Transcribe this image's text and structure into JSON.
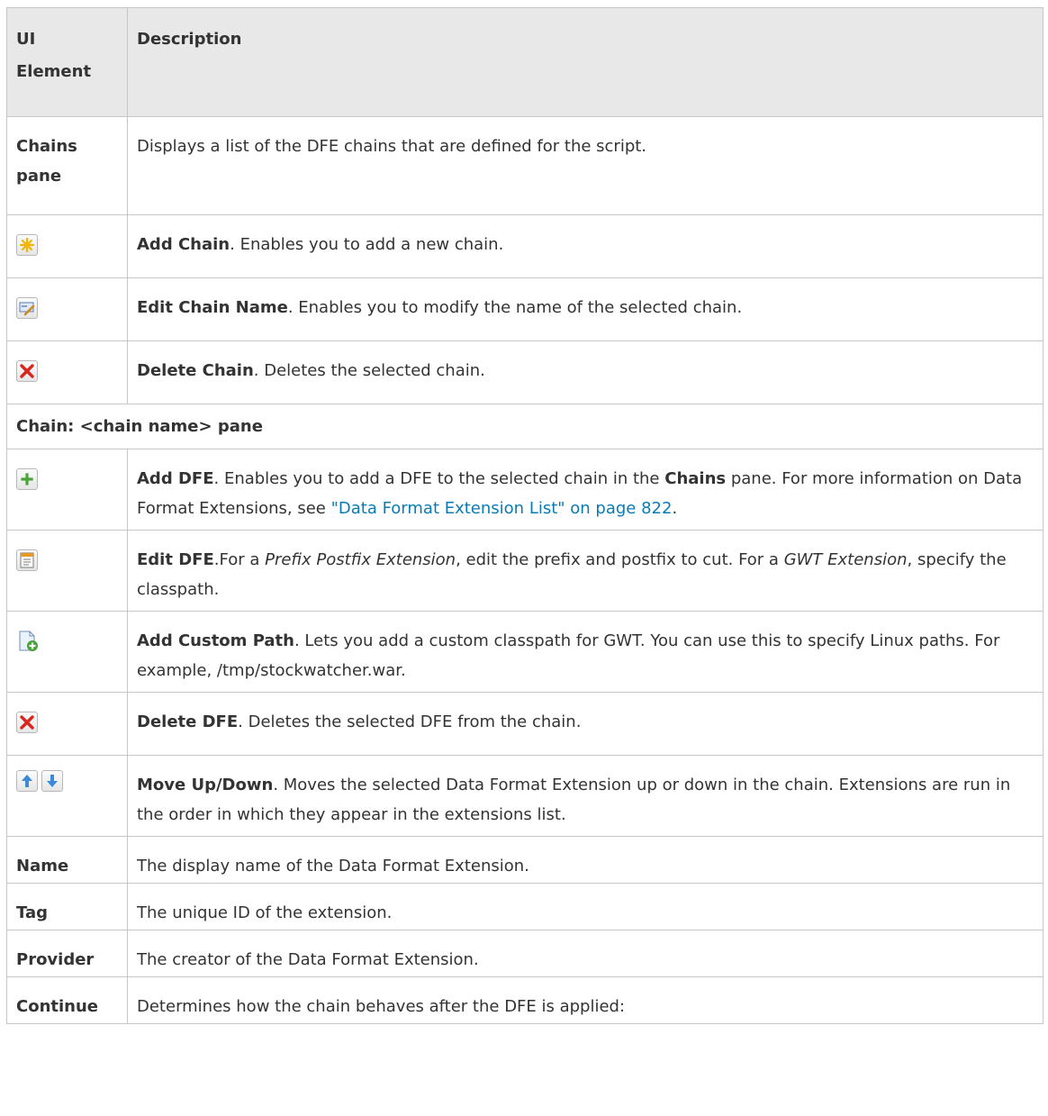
{
  "header": {
    "col1": "UI Element",
    "col1_line1": "UI",
    "col1_line2": "Element",
    "col2": "Description"
  },
  "rows": {
    "chains_pane": {
      "name_line1": "Chains",
      "name_line2": "pane",
      "desc": "Displays a list of the DFE chains that are defined for the script."
    },
    "add_chain": {
      "icon": "add-chain-star-icon",
      "title": "Add Chain",
      "desc": ". Enables you to add a new chain."
    },
    "edit_chain_name": {
      "icon": "edit-chain-name-icon",
      "title": "Edit Chain Name",
      "desc": ". Enables you to modify the name of the selected chain."
    },
    "delete_chain": {
      "icon": "delete-red-x-icon",
      "title": "Delete Chain",
      "desc": ". Deletes the selected chain."
    },
    "section": {
      "label": "Chain: <chain name> pane"
    },
    "add_dfe": {
      "icon": "add-green-plus-icon",
      "title": "Add DFE",
      "desc_a": ". Enables you to add a DFE to the selected chain in the ",
      "desc_bold": "Chains",
      "desc_b": " pane. For more information on Data Format Extensions, see ",
      "link": "\"Data Format Extension List\" on page 822",
      "desc_c": "."
    },
    "edit_dfe": {
      "icon": "edit-properties-icon",
      "title": "Edit DFE",
      "desc_a": ".For a ",
      "ital1": "Prefix Postfix Extension",
      "desc_b": ", edit the prefix and postfix to cut. For a ",
      "ital2": "GWT Extension",
      "desc_c": ", specify the classpath."
    },
    "add_custom_path": {
      "icon": "add-custom-path-document-icon",
      "title": "Add Custom Path",
      "desc": ". Lets you add a custom classpath for GWT. You can use this to specify Linux paths. For example, /tmp/stockwatcher.war."
    },
    "delete_dfe": {
      "icon": "delete-red-x-icon",
      "title": "Delete DFE",
      "desc": ". Deletes the selected DFE from the chain."
    },
    "move_up_down": {
      "icon_up": "arrow-up-icon",
      "icon_down": "arrow-down-icon",
      "title": "Move Up/Down",
      "desc": ". Moves the selected Data Format Extension up or down in the chain. Extensions are run in the order in which they appear in the extensions list."
    },
    "name": {
      "name": "Name",
      "desc": "The display name of the Data Format Extension."
    },
    "tag": {
      "name": "Tag",
      "desc": "The unique ID of the extension."
    },
    "provider": {
      "name": "Provider",
      "desc": "The creator of the Data Format Extension."
    },
    "continue": {
      "name": "Continue",
      "desc": "Determines how the chain behaves after the DFE is applied:"
    }
  },
  "colors": {
    "header_bg": "#e8e8e8",
    "border": "#c6c6c6",
    "link": "#0a7bb6",
    "text": "#333333"
  }
}
